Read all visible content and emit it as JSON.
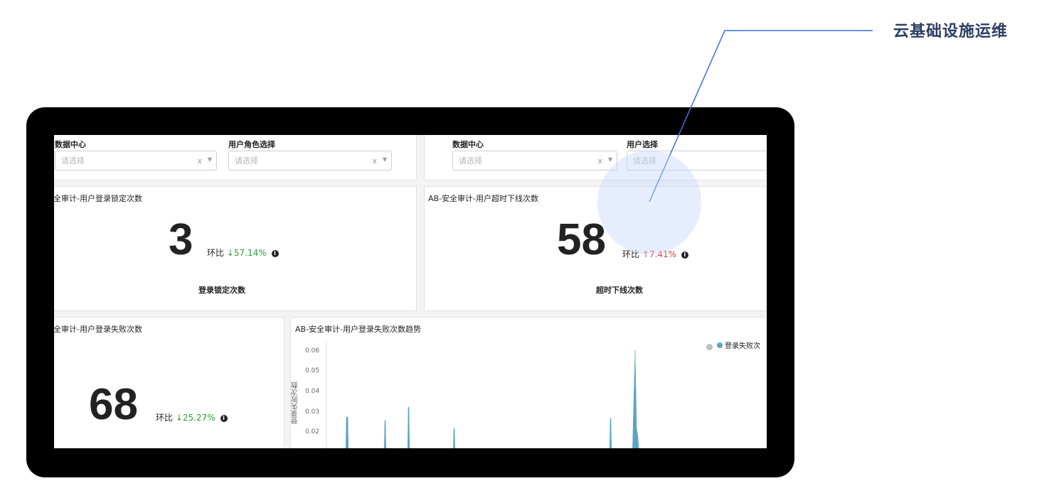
{
  "callout": {
    "title": "云基础设施运维"
  },
  "filters_left": {
    "datacenter_label": "数据中心",
    "datacenter_placeholder": "请选择",
    "role_label": "用户角色选择",
    "role_placeholder": "请选择",
    "clear_glyph": "x",
    "arrow_glyph": "▼"
  },
  "filters_right": {
    "datacenter_label": "数据中心",
    "datacenter_placeholder": "请选择",
    "user_label": "用户选择",
    "user_placeholder": "请选择",
    "clear_glyph": "x",
    "arrow_glyph": "▼"
  },
  "panel_lock": {
    "title": "全审计-用户登录锁定次数",
    "value": "3",
    "ratio_label": "环比",
    "arrow": "↓",
    "change": "57.14%",
    "info_icon": "i",
    "metric_label": "登录锁定次数"
  },
  "panel_timeout": {
    "title": "AB-安全审计-用户超时下线次数",
    "value": "58",
    "ratio_label": "环比",
    "arrow": "↑",
    "change": "7.41%",
    "info_icon": "i",
    "metric_label": "超时下线次数"
  },
  "panel_fail": {
    "title": "全审计-用户登录失败次数",
    "value": "68",
    "ratio_label": "环比",
    "arrow": "↓",
    "change": "25.27%",
    "info_icon": "i"
  },
  "panel_trend": {
    "title": "AB-安全审计-用户登录失败次数趋势",
    "y_axis_label": "登录失败次数",
    "legend_label": "登录失败次",
    "y_ticks": [
      "0.06",
      "0.05",
      "0.04",
      "0.03",
      "0.02"
    ]
  },
  "colors": {
    "series": "#5aa4c4",
    "down": "#2e9a3a",
    "up": "#e23c3c",
    "callout_line": "#3b6fe0"
  }
}
